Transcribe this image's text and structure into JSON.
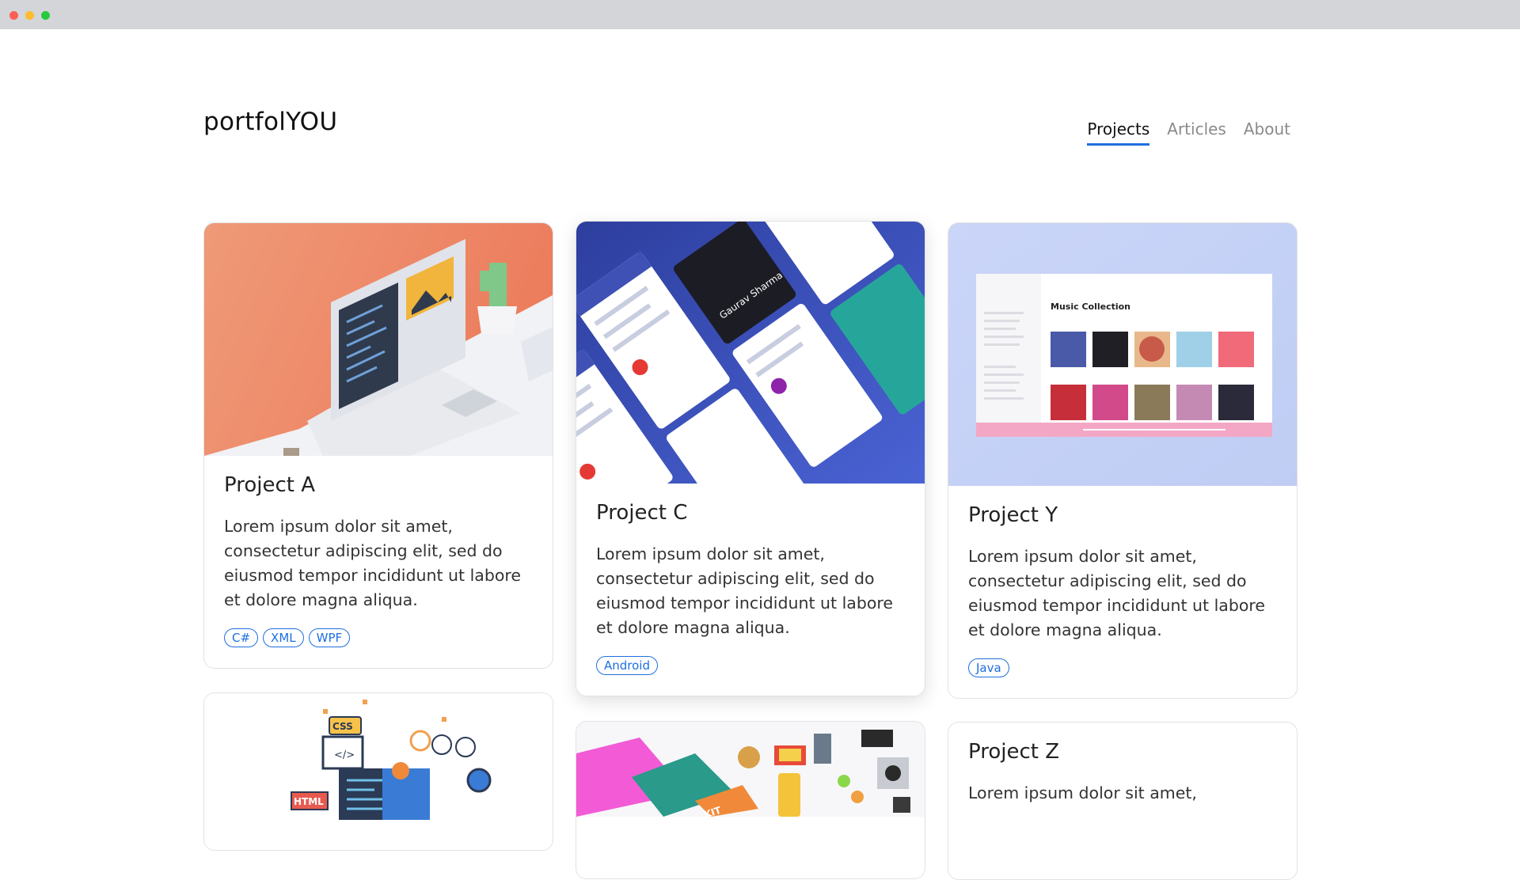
{
  "window": {
    "controls": [
      "close",
      "minimize",
      "maximize"
    ]
  },
  "header": {
    "logo": "portfolYOU",
    "nav": [
      {
        "label": "Projects",
        "active": true
      },
      {
        "label": "Articles",
        "active": false
      },
      {
        "label": "About",
        "active": false
      }
    ]
  },
  "colors": {
    "accent": "#1e6fe0",
    "project_a_bg": "#ee8a6a",
    "project_y_bg": "#c5d3f6",
    "project_c_bg": "#3b4fb8"
  },
  "projects": [
    {
      "title": "Project A",
      "description": "Lorem ipsum dolor sit amet, consectetur adipiscing elit, sed do eiusmod tempor incididunt ut labore et dolore magna aliqua.",
      "tags": [
        "C#",
        "XML",
        "WPF"
      ]
    },
    {
      "title": "Project C",
      "description": "Lorem ipsum dolor sit amet, consectetur adipiscing elit, sed do eiusmod tempor incididunt ut labore et dolore magna aliqua.",
      "tags": [
        "Android"
      ],
      "image_text": "Gaurav Sharma"
    },
    {
      "title": "Project Y",
      "description": "Lorem ipsum dolor sit amet, consectetur adipiscing elit, sed do eiusmod tempor incididunt ut labore et dolore magna aliqua.",
      "tags": [
        "Java"
      ],
      "image_text": "Music Collection"
    },
    {
      "title": "Project Z",
      "description": "Lorem ipsum dolor sit amet,"
    },
    {
      "image_labels": [
        "CSS",
        "HTML"
      ]
    },
    {
      "image_labels": [
        "KIT"
      ]
    }
  ]
}
